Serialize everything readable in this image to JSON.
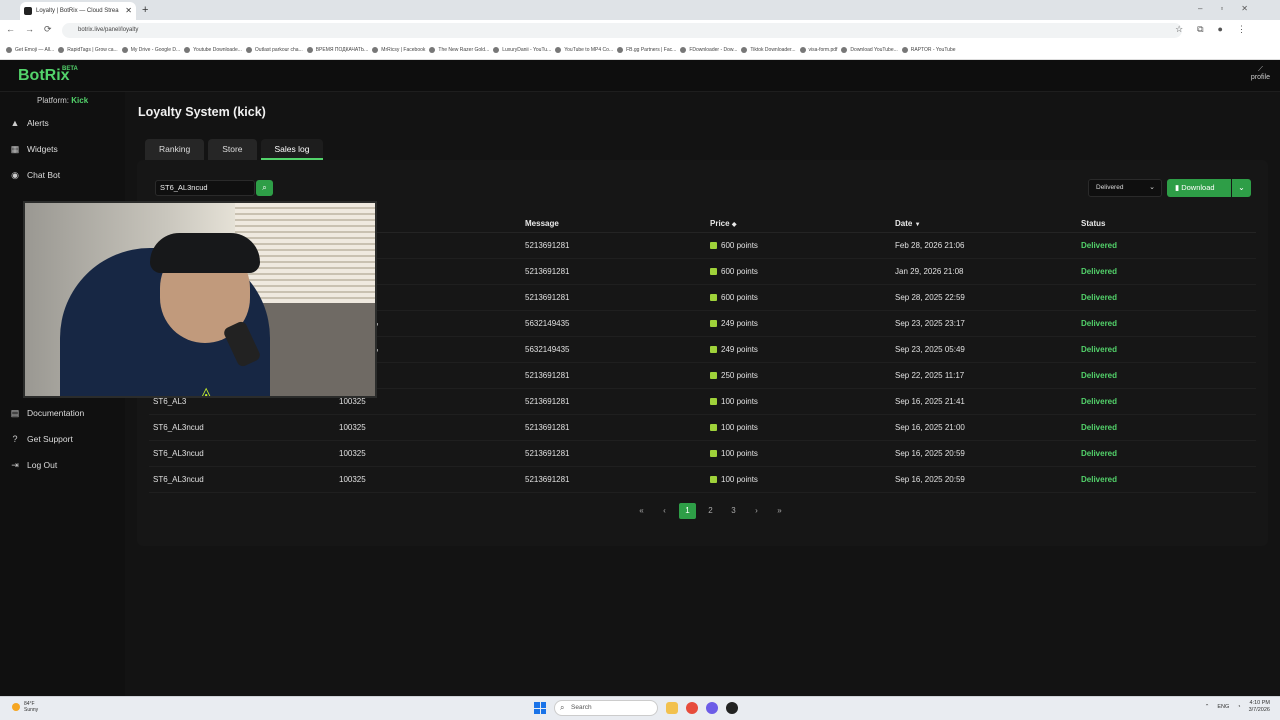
{
  "browser": {
    "tab_title": "Loyalty | BotRix — Cloud Strea",
    "url": "botrix.live/panel/loyalty",
    "bookmarks": [
      "Get Emoji — All...",
      "RapidTags | Grow ca...",
      "My Drive - Google D...",
      "Youtube Downloade...",
      "Outlast parkour cha...",
      "ВРЕМЯ ПОДКАЧАТЬ...",
      "MrRicsy | Facebook",
      "The New Razer Gold...",
      "LuxuryDanii - YouTu...",
      "YouTube to MP4 Co...",
      "FB.gg Partners | Fac...",
      "FDownloader - Dow...",
      "Tiktok Downloader...",
      "visa-form.pdf",
      "Download YouTube...",
      "RAPTOR - YouTube"
    ]
  },
  "app": {
    "logo": "BotRix",
    "beta": "BETA",
    "profile": "profile",
    "platform_label": "Platform:",
    "platform_value": "Kick"
  },
  "sidebar": {
    "items": [
      {
        "label": "Alerts",
        "icon": "bell-icon"
      },
      {
        "label": "Widgets",
        "icon": "grid-icon"
      },
      {
        "label": "Chat Bot",
        "icon": "chat-icon"
      },
      {
        "label": "Documentation",
        "icon": "document-icon"
      },
      {
        "label": "Get Support",
        "icon": "help-icon"
      },
      {
        "label": "Log Out",
        "icon": "logout-icon"
      }
    ]
  },
  "main": {
    "title": "Loyalty System (kick)",
    "tabs": [
      "Ranking",
      "Store",
      "Sales log"
    ],
    "active_tab": "Sales log",
    "search_value": "ST6_AL3ncud",
    "status_filter": "Delivered",
    "download_label": "Download",
    "columns": [
      "Message",
      "Price",
      "Date",
      "Status"
    ],
    "rows": [
      {
        "user": "",
        "item": "",
        "message": "5213691281",
        "price": "600 points",
        "date": "Feb 28, 2026 21:06",
        "status": "Delivered"
      },
      {
        "user": "",
        "item": "",
        "message": "5213691281",
        "price": "600 points",
        "date": "Jan 29, 2026 21:08",
        "status": "Delivered"
      },
      {
        "user": "",
        "item": "",
        "message": "5213691281",
        "price": "600 points",
        "date": "Sep 28, 2025 22:59",
        "status": "Delivered"
      },
      {
        "user": "",
        "item": "شدات ببجي",
        "message": "5632149435",
        "price": "249 points",
        "date": "Sep 23, 2025 23:17",
        "status": "Delivered"
      },
      {
        "user": "",
        "item": "شدات ببجي",
        "message": "5632149435",
        "price": "249 points",
        "date": "Sep 23, 2025 05:49",
        "status": "Delivered"
      },
      {
        "user": "",
        "item": "",
        "message": "5213691281",
        "price": "250 points",
        "date": "Sep 22, 2025 11:17",
        "status": "Delivered"
      },
      {
        "user": "ST6_AL3",
        "item": "100325",
        "message": "5213691281",
        "price": "100 points",
        "date": "Sep 16, 2025 21:41",
        "status": "Delivered"
      },
      {
        "user": "ST6_AL3ncud",
        "item": "100325",
        "message": "5213691281",
        "price": "100 points",
        "date": "Sep 16, 2025 21:00",
        "status": "Delivered"
      },
      {
        "user": "ST6_AL3ncud",
        "item": "100325",
        "message": "5213691281",
        "price": "100 points",
        "date": "Sep 16, 2025 20:59",
        "status": "Delivered"
      },
      {
        "user": "ST6_AL3ncud",
        "item": "100325",
        "message": "5213691281",
        "price": "100 points",
        "date": "Sep 16, 2025 20:59",
        "status": "Delivered"
      }
    ],
    "pages": [
      "1",
      "2",
      "3"
    ],
    "current_page": "1"
  },
  "taskbar": {
    "weather_temp": "84°F",
    "weather_desc": "Sunny",
    "search": "Search",
    "lang": "ENG",
    "time": "4:10 PM",
    "date": "3/7/2026"
  },
  "colors": {
    "accent": "#53d36b",
    "button": "#2e9e47",
    "background": "#131313"
  }
}
